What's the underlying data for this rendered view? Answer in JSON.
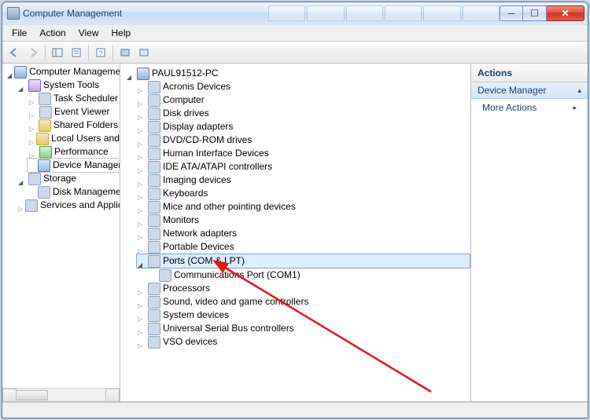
{
  "window": {
    "title": "Computer Management"
  },
  "menubar": [
    "File",
    "Action",
    "View",
    "Help"
  ],
  "left_tree": {
    "root": "Computer Management",
    "system_tools": {
      "label": "System Tools",
      "children": [
        "Task Scheduler",
        "Event Viewer",
        "Shared Folders",
        "Local Users and Groups",
        "Performance",
        "Device Manager"
      ]
    },
    "storage": {
      "label": "Storage",
      "children": [
        "Disk Management"
      ]
    },
    "services": {
      "label": "Services and Applications"
    }
  },
  "mid_tree": {
    "root": "PAUL91512-PC",
    "items": [
      "Acronis Devices",
      "Computer",
      "Disk drives",
      "Display adapters",
      "DVD/CD-ROM drives",
      "Human Interface Devices",
      "IDE ATA/ATAPI controllers",
      "Imaging devices",
      "Keyboards",
      "Mice and other pointing devices",
      "Monitors",
      "Network adapters",
      "Portable Devices"
    ],
    "ports": {
      "label": "Ports (COM & LPT)",
      "child": "Communications Port (COM1)"
    },
    "items_after": [
      "Processors",
      "Sound, video and game controllers",
      "System devices",
      "Universal Serial Bus controllers",
      "VSO devices"
    ]
  },
  "actions": {
    "header": "Actions",
    "section": "Device Manager",
    "more": "More Actions"
  }
}
